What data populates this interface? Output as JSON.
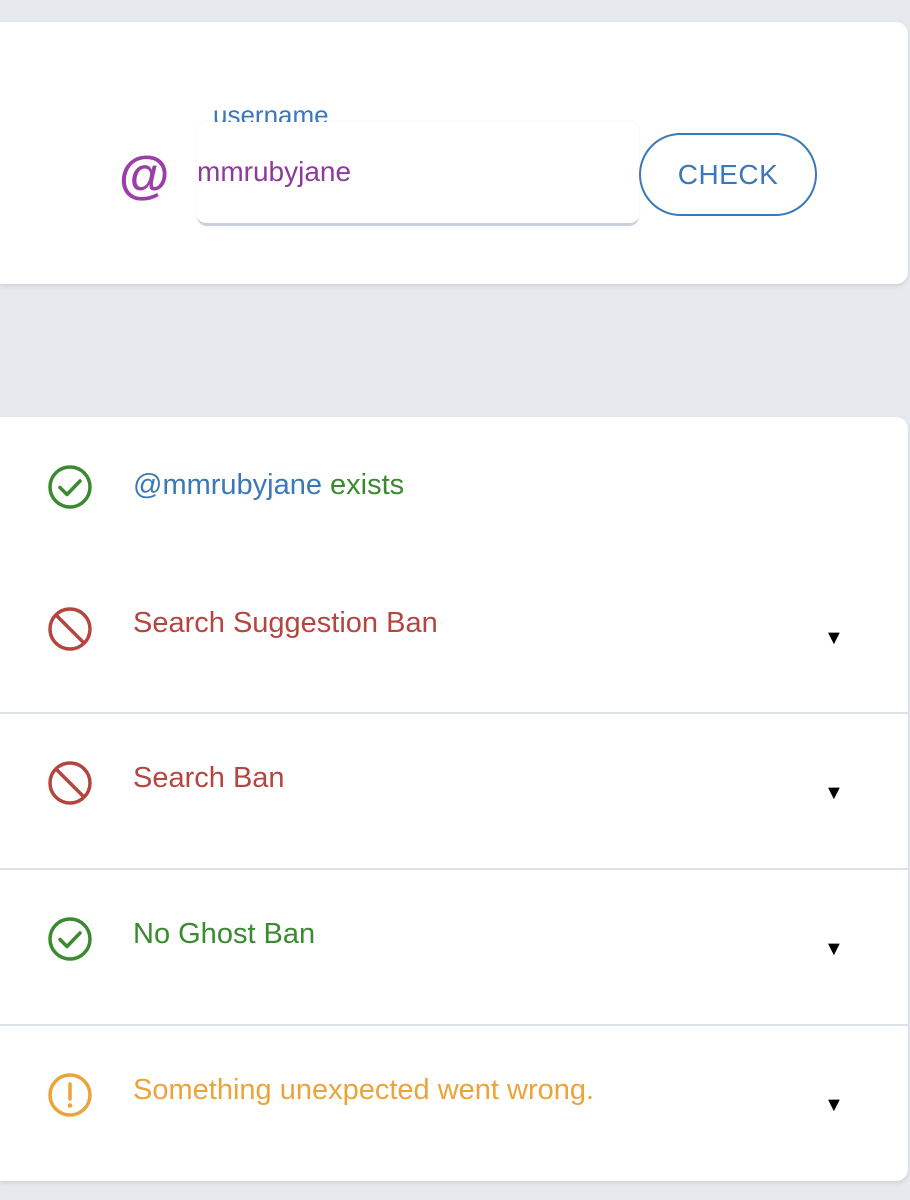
{
  "search": {
    "at_symbol": "@",
    "field_label": "username",
    "field_value": "mmrubyjane",
    "check_label": "CHECK"
  },
  "results": {
    "exists": {
      "handle": "@mmrubyjane",
      "suffix": " exists",
      "icon": "check-circle-icon",
      "color": "#3a8a2f"
    },
    "items": [
      {
        "label": "Search Suggestion Ban",
        "icon": "ban-icon",
        "color": "#b5463f",
        "caret": "▼"
      },
      {
        "label": "Search Ban",
        "icon": "ban-icon",
        "color": "#b5463f",
        "caret": "▼"
      },
      {
        "label": "No Ghost Ban",
        "icon": "check-circle-icon",
        "color": "#3a8a2f",
        "caret": "▼"
      },
      {
        "label": "Something unexpected went wrong.",
        "icon": "warning-circle-icon",
        "color": "#eba43a",
        "caret": "▼"
      }
    ]
  },
  "colors": {
    "background": "#e6e9ee",
    "accent_blue": "#3a78b8",
    "username_purple": "#8e3a9c",
    "success_green": "#3a8a2f",
    "error_red": "#b5463f",
    "warning_orange": "#eba43a"
  }
}
